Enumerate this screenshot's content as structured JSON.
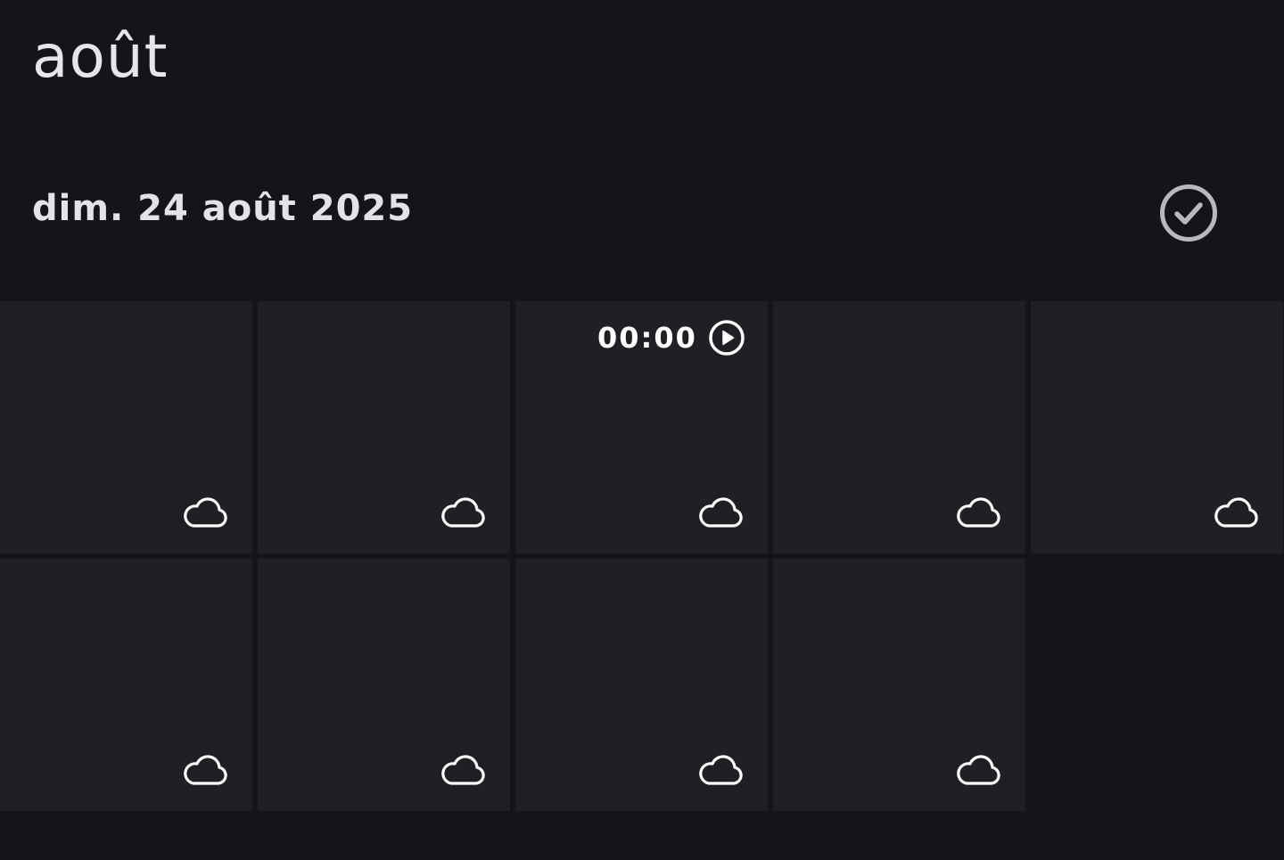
{
  "month_title": "août",
  "date_header": "dim. 24 août 2025",
  "select_icon": "check-circle-icon",
  "tiles": [
    {
      "cloud_icon": "cloud-icon"
    },
    {
      "cloud_icon": "cloud-icon"
    },
    {
      "cloud_icon": "cloud-icon",
      "video": true,
      "duration": "00:00",
      "play_icon": "play-circle-icon"
    },
    {
      "cloud_icon": "cloud-icon"
    },
    {
      "cloud_icon": "cloud-icon"
    },
    {
      "cloud_icon": "cloud-icon"
    },
    {
      "cloud_icon": "cloud-icon"
    },
    {
      "cloud_icon": "cloud-icon"
    },
    {
      "cloud_icon": "cloud-icon"
    }
  ],
  "colors": {
    "background": "#14151a",
    "tile": "#1e2024",
    "text": "#e6e6ea",
    "icon_muted": "#b8b9bd"
  }
}
